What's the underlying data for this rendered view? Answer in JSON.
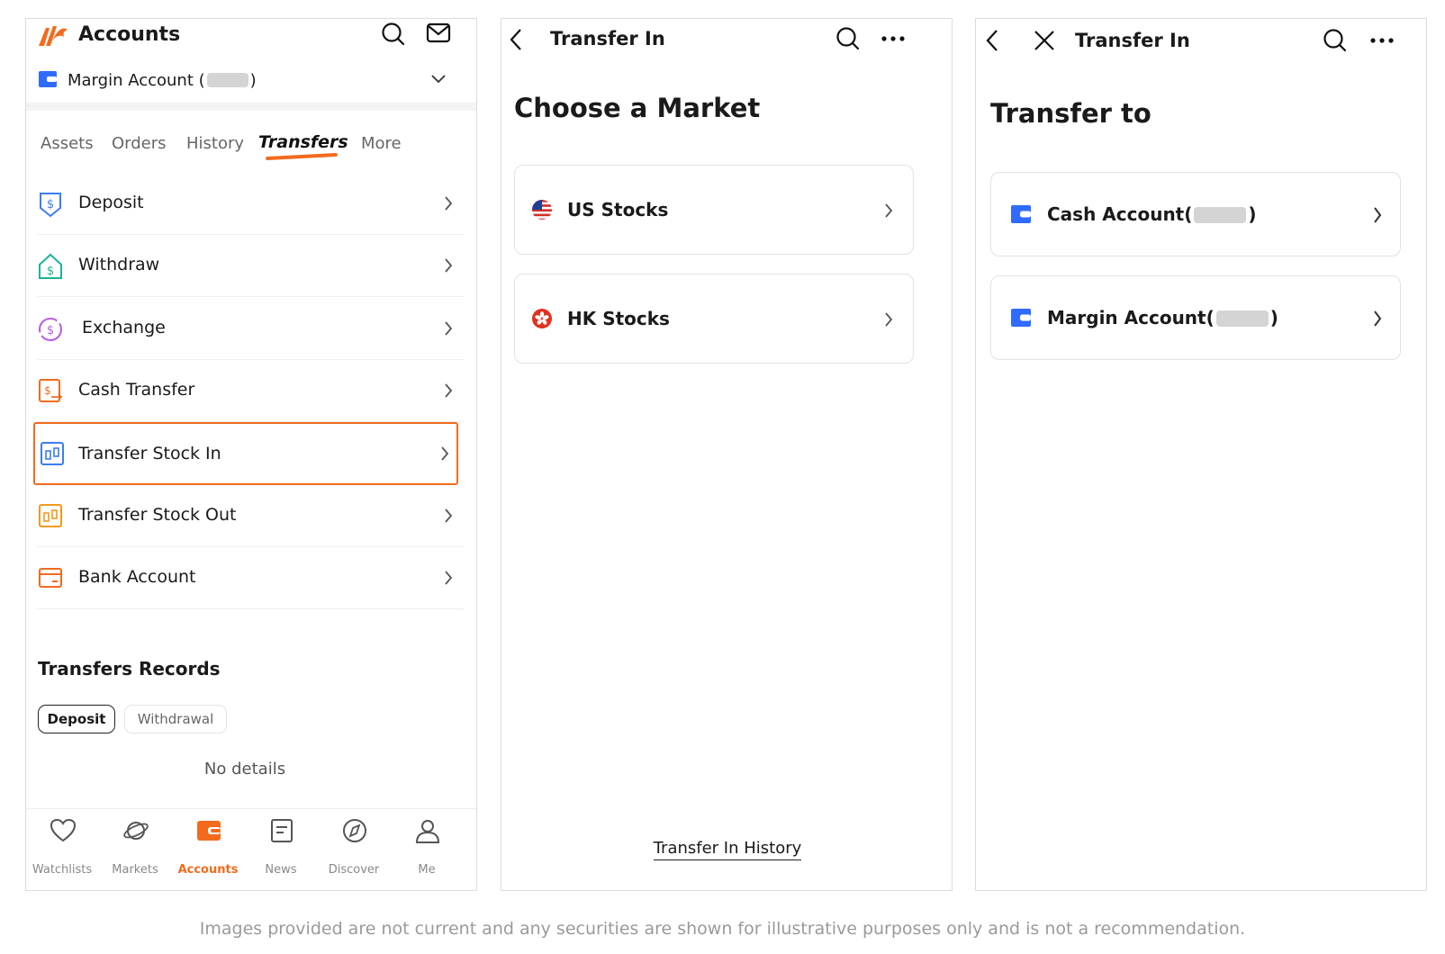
{
  "screen1": {
    "title": "Accounts",
    "account_selector_prefix": "Margin Account (",
    "account_selector_suffix": ")",
    "tabs": [
      {
        "label": "Assets"
      },
      {
        "label": "Orders"
      },
      {
        "label": "History"
      },
      {
        "label": "Transfers",
        "active": true
      },
      {
        "label": "More"
      }
    ],
    "menu": [
      {
        "label": "Deposit",
        "icon": "deposit-icon"
      },
      {
        "label": "Withdraw",
        "icon": "withdraw-icon"
      },
      {
        "label": "Exchange",
        "icon": "exchange-icon"
      },
      {
        "label": "Cash Transfer",
        "icon": "cash-transfer-icon"
      },
      {
        "label": "Transfer Stock In",
        "icon": "transfer-stock-in-icon",
        "highlighted": true
      },
      {
        "label": "Transfer Stock Out",
        "icon": "transfer-stock-out-icon"
      },
      {
        "label": "Bank Account",
        "icon": "bank-card-icon"
      }
    ],
    "records_title": "Transfers Records",
    "record_filters": [
      {
        "label": "Deposit",
        "selected": true
      },
      {
        "label": "Withdrawal",
        "selected": false
      }
    ],
    "empty_state": "No details",
    "bottom_nav": [
      {
        "label": "Watchlists",
        "icon": "heart-icon"
      },
      {
        "label": "Markets",
        "icon": "planet-icon"
      },
      {
        "label": "Accounts",
        "icon": "wallet-icon",
        "active": true
      },
      {
        "label": "News",
        "icon": "news-icon"
      },
      {
        "label": "Discover",
        "icon": "compass-icon"
      },
      {
        "label": "Me",
        "icon": "person-icon"
      }
    ]
  },
  "screen2": {
    "header_title": "Transfer In",
    "title": "Choose a Market",
    "markets": [
      {
        "label": "US Stocks",
        "icon": "us-flag-icon"
      },
      {
        "label": "HK Stocks",
        "icon": "hk-flag-icon"
      }
    ],
    "history_link": "Transfer In History"
  },
  "screen3": {
    "header_title": "Transfer In",
    "title": "Transfer to",
    "accounts": [
      {
        "prefix": "Cash Account(",
        "suffix": ")"
      },
      {
        "prefix": "Margin Account(",
        "suffix": ")"
      }
    ]
  },
  "disclaimer": "Images provided are not current and any securities are shown for illustrative purposes only and is not a recommendation.",
  "colors": {
    "accent": "#f26b1d",
    "account_blue": "#2f6bff",
    "text": "#1a1a1a",
    "muted": "#888888",
    "border": "#dcdcdc"
  }
}
